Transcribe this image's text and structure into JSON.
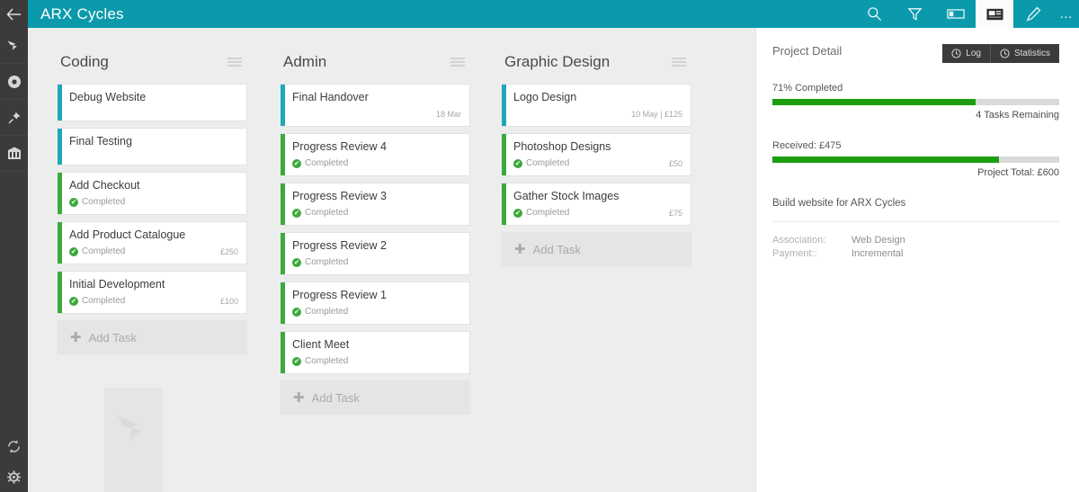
{
  "app": {
    "title": "ARX Cycles",
    "accent": "#0b9aab",
    "rail_bg": "#3b3b3b",
    "board_bg": "#eceeed"
  },
  "topbar": {
    "back_icon": "back-arrow-icon",
    "actions": [
      {
        "name": "search-icon",
        "label": "Search"
      },
      {
        "name": "filter-icon",
        "label": "Filter"
      },
      {
        "name": "layout-icon",
        "label": "Layout"
      },
      {
        "name": "card-view-icon",
        "label": "Card View"
      },
      {
        "name": "edit-pencil-icon",
        "label": "Edit"
      },
      {
        "name": "more-icon",
        "label": "…"
      }
    ]
  },
  "rail": {
    "items": [
      {
        "name": "bird-logo-icon",
        "label": "Home"
      },
      {
        "name": "record-dot-icon",
        "label": "Projects"
      },
      {
        "name": "pushpin-icon",
        "label": "Pinned"
      },
      {
        "name": "chart-icon",
        "label": "Reports"
      }
    ],
    "bottom": [
      {
        "name": "sync-icon",
        "label": "Sync"
      },
      {
        "name": "gear-icon",
        "label": "Settings"
      }
    ]
  },
  "board": {
    "completed_label": "Completed",
    "add_task_label": "Add Task",
    "colors": {
      "active": "#1fa8b8",
      "completed": "#3ba93b"
    },
    "columns": [
      {
        "title": "Coding",
        "tasks": [
          {
            "title": "Debug Website",
            "status": "",
            "meta": "",
            "state": "active",
            "tall": true
          },
          {
            "title": "Final Testing",
            "status": "",
            "meta": "",
            "state": "active",
            "tall": true
          },
          {
            "title": "Add Checkout",
            "status": "Completed",
            "meta": "",
            "state": "completed",
            "tall": false
          },
          {
            "title": "Add Product Catalogue",
            "status": "Completed",
            "meta": "£250",
            "state": "completed",
            "tall": false
          },
          {
            "title": "Initial Development",
            "status": "Completed",
            "meta": "£100",
            "state": "completed",
            "tall": false
          }
        ]
      },
      {
        "title": "Admin",
        "tasks": [
          {
            "title": "Final Handover",
            "status": "",
            "meta": "18 Mar",
            "state": "active",
            "tall": true
          },
          {
            "title": "Progress Review 4",
            "status": "Completed",
            "meta": "",
            "state": "completed",
            "tall": false
          },
          {
            "title": "Progress Review 3",
            "status": "Completed",
            "meta": "",
            "state": "completed",
            "tall": false
          },
          {
            "title": "Progress Review 2",
            "status": "Completed",
            "meta": "",
            "state": "completed",
            "tall": false
          },
          {
            "title": "Progress Review 1",
            "status": "Completed",
            "meta": "",
            "state": "completed",
            "tall": false
          },
          {
            "title": "Client Meet",
            "status": "Completed",
            "meta": "",
            "state": "completed",
            "tall": false
          }
        ]
      },
      {
        "title": "Graphic Design",
        "tasks": [
          {
            "title": "Logo Design",
            "status": "",
            "meta": "10 May | £125",
            "state": "active",
            "tall": true
          },
          {
            "title": "Photoshop Designs",
            "status": "Completed",
            "meta": "£50",
            "state": "completed",
            "tall": false
          },
          {
            "title": "Gather Stock Images",
            "status": "Completed",
            "meta": "£75",
            "state": "completed",
            "tall": false
          }
        ]
      }
    ]
  },
  "detail": {
    "title": "Project Detail",
    "log_label": "Log",
    "statistics_label": "Statistics",
    "progress": {
      "label": "71% Completed",
      "percent": 71,
      "remaining": "4 Tasks Remaining"
    },
    "payment": {
      "label": "Received: £475",
      "percent": 79,
      "total": "Project Total: £600"
    },
    "description": "Build website for ARX Cycles",
    "fields": {
      "keys": "Association:\nPayment::",
      "values": "Web Design\nIncremental",
      "association_key": "Association:",
      "association_value": "Web Design",
      "payment_key": "Payment::",
      "payment_value": "Incremental"
    }
  }
}
